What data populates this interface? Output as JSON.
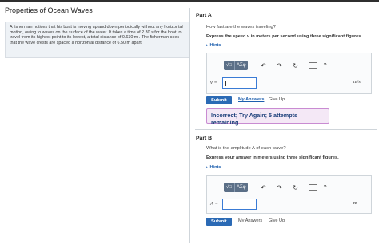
{
  "page": {
    "title": "Properties of Ocean Waves",
    "problem_text": "A fisherman notices that his boat is moving up and down periodically without any horizontal motion, owing to waves on the surface of the water. It takes a time of 2.30 s for the boat to travel from its highest point to its lowest, a total distance of 0.630 m . The fisherman sees that the wave crests are spaced a horizontal distance of 6.50 m apart."
  },
  "part_a": {
    "label": "Part A",
    "question": "How fast are the waves traveling?",
    "instruction": "Express the speed v in meters per second using three significant figures.",
    "hints": "Hints",
    "variable": "v =",
    "input_value": "",
    "unit": "m/s",
    "submit": "Submit",
    "my_answers": "My Answers",
    "give_up": "Give Up",
    "feedback": "Incorrect; Try Again; 5 attempts remaining"
  },
  "part_b": {
    "label": "Part B",
    "question": "What is the amplitude A of each wave?",
    "instruction": "Express your answer in meters using three significant figures.",
    "hints": "Hints",
    "variable": "A =",
    "input_value": "",
    "unit": "m",
    "submit": "Submit",
    "my_answers": "My Answers",
    "give_up": "Give Up"
  },
  "toolbar": {
    "template_btn": "√□",
    "symbols_btn": "ΑΣφ",
    "undo_icon": "↶",
    "redo_icon": "↷",
    "reset_icon": "↻",
    "help_icon": "?"
  },
  "colors": {
    "accent": "#2b6ab5",
    "link": "#1d5fae",
    "feedback_bg": "#f4e8f6",
    "feedback_border": "#c98bd2"
  }
}
